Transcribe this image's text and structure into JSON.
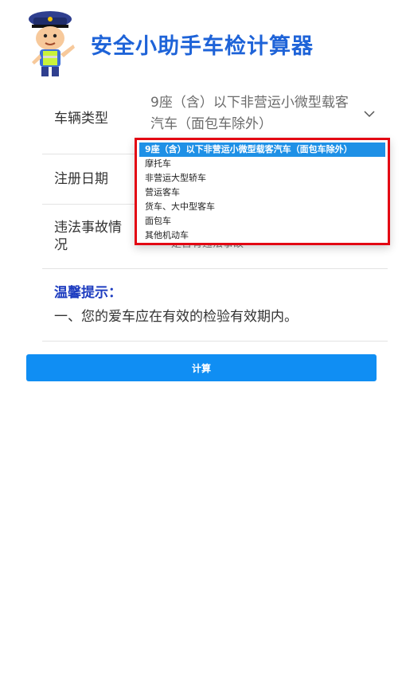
{
  "app": {
    "title": "安全小助手车检计算器"
  },
  "form": {
    "vehicle_type": {
      "label": "车辆类型",
      "selected": "9座（含）以下非营运小微型载客汽车（面包车除外）"
    },
    "registration_date": {
      "label": "注册日期"
    },
    "violations": {
      "label": "违法事故情况",
      "value": "是否有违法事故"
    }
  },
  "tips": {
    "title": "温馨提示：",
    "text": "一、您的爱车应在有效的检验有效期内。"
  },
  "actions": {
    "calculate_label": "计算"
  },
  "dropdown": {
    "options": [
      "9座（含）以下非营运小微型载客汽车（面包车除外）",
      "摩托车",
      "非营运大型轿车",
      "营运客车",
      "货车、大中型客车",
      "面包车",
      "其他机动车"
    ]
  }
}
